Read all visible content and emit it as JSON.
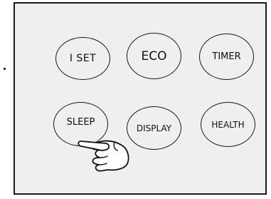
{
  "buttons": {
    "i_set": "I SET",
    "eco": "ECO",
    "timer": "TIMER",
    "sleep": "SLEEP",
    "display": "DISPLAY",
    "health": "HEALTH"
  },
  "icons": {
    "pointer": "pointing-hand-icon"
  }
}
